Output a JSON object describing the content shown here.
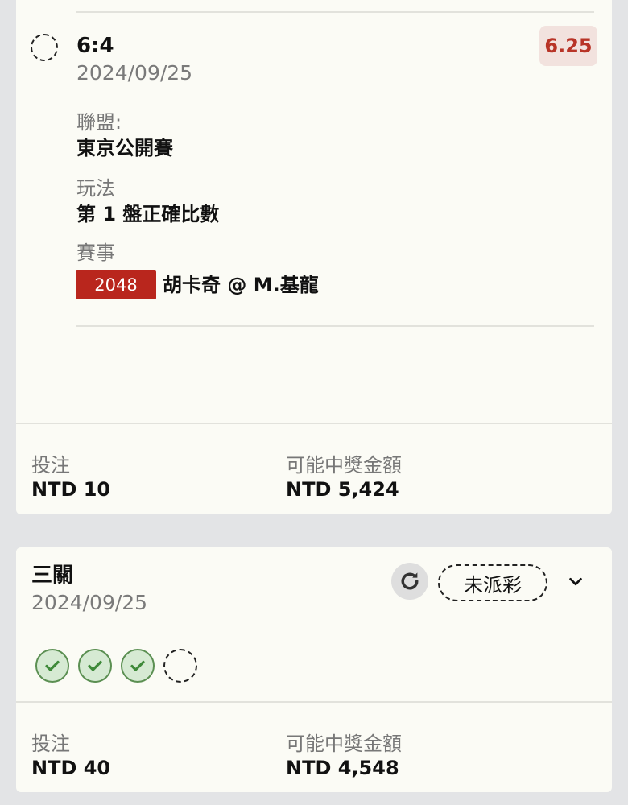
{
  "bet1": {
    "score": "6:4",
    "date": "2024/09/25",
    "odds": "6.25",
    "league_label": "聯盟:",
    "league_value": "東京公開賽",
    "market_label": "玩法",
    "market_value": "第 1 盤正確比數",
    "event_label": "賽事",
    "event_id": "2048",
    "event_name": "胡卡奇 @ M.基龍",
    "stake_label": "投注",
    "stake_value": "NTD 10",
    "payout_label": "可能中獎金額",
    "payout_value": "NTD 5,424"
  },
  "bet2": {
    "title": "三關",
    "date": "2024/09/25",
    "status": "未派彩",
    "legs": [
      "won",
      "won",
      "won",
      "pending"
    ],
    "stake_label": "投注",
    "stake_value": "NTD 40",
    "payout_label": "可能中獎金額",
    "payout_value": "NTD 4,548"
  },
  "icons": {
    "refresh": "refresh-icon",
    "expand": "chevron-down-icon",
    "leg_won": "check-circle-icon",
    "leg_pending": "dashed-circle-icon"
  },
  "colors": {
    "odds_text": "#b83427",
    "odds_bg": "#f2e2de",
    "badge_bg": "#b9261d",
    "check_green": "#3f8a3a",
    "page_bg": "#e3e4e6",
    "card_bg": "#fbfbf5"
  }
}
